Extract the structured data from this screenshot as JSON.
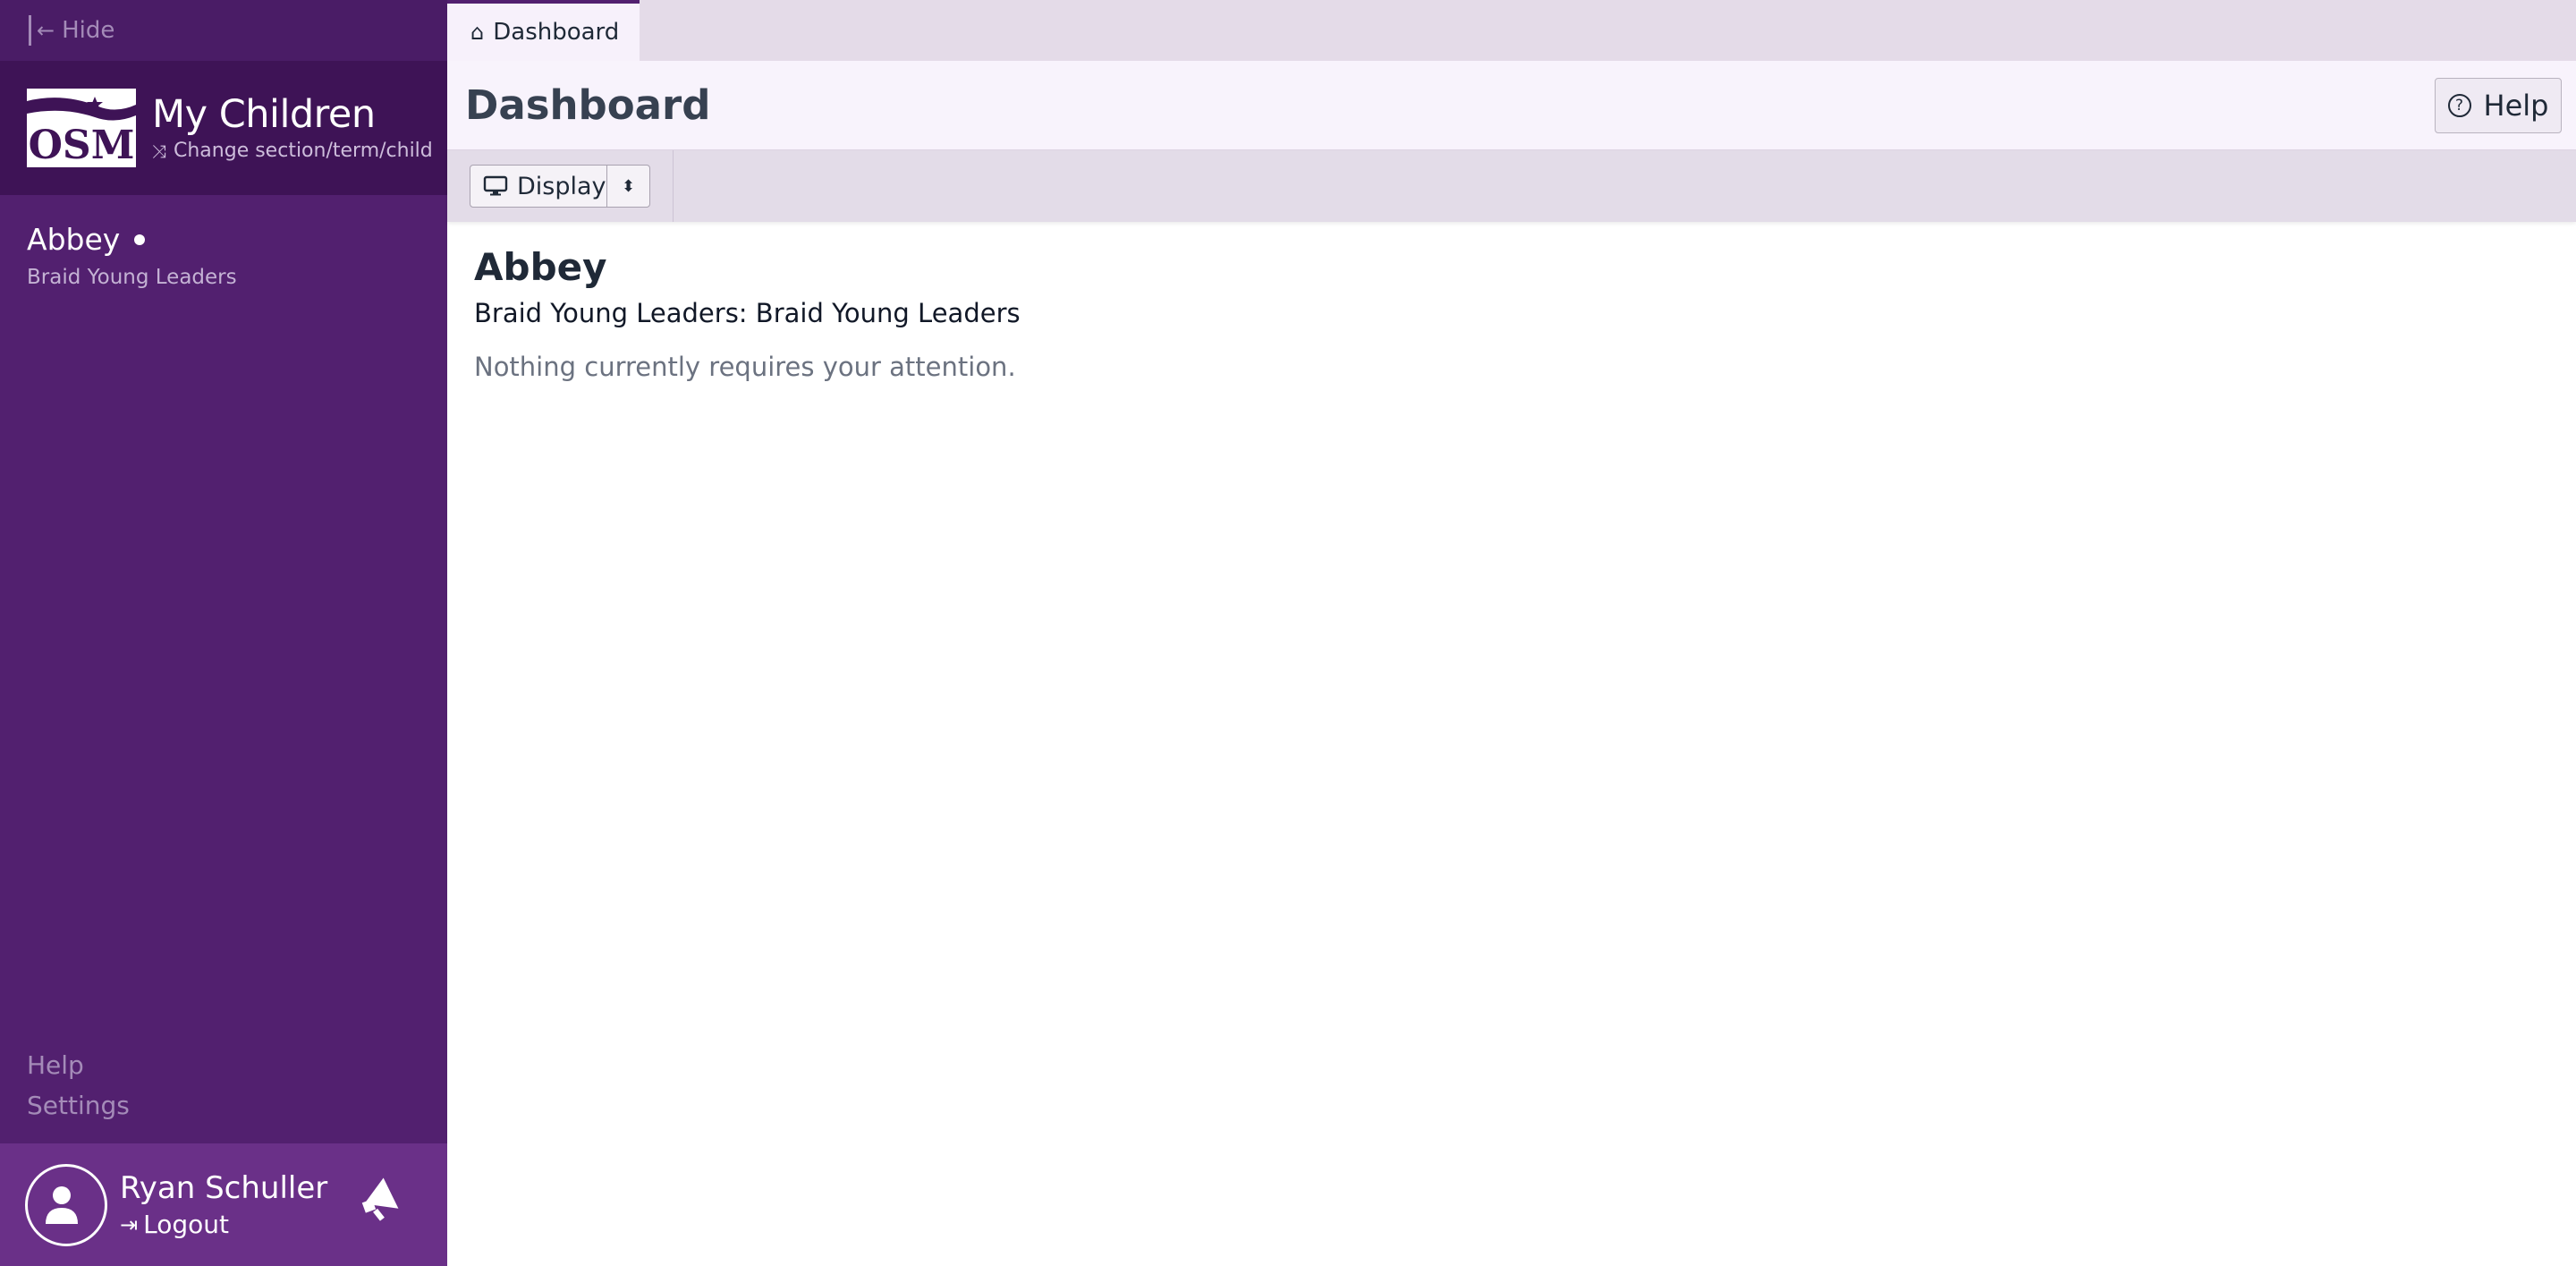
{
  "sidebar": {
    "hide_label": "Hide",
    "logo_text": "OSM",
    "title": "My Children",
    "change_label": "Change section/term/child",
    "child": {
      "name": "Abbey",
      "section": "Braid Young Leaders"
    },
    "links": [
      "Help",
      "Settings"
    ],
    "user": {
      "name": "Ryan Schuller",
      "logout_label": "Logout"
    }
  },
  "tabs": [
    {
      "label": "Dashboard",
      "icon": "home-icon"
    }
  ],
  "header": {
    "title": "Dashboard",
    "help_label": "Help"
  },
  "toolbar": {
    "display_label": "Display"
  },
  "content": {
    "heading": "Abbey",
    "subheading": "Braid Young Leaders: Braid Young Leaders",
    "message": "Nothing currently requires your attention."
  },
  "colors": {
    "sidebar_bg": "#52206f",
    "brand_bg": "#3e1356",
    "user_bar_bg": "#6a3088",
    "header_bg": "#f8f3fc"
  }
}
